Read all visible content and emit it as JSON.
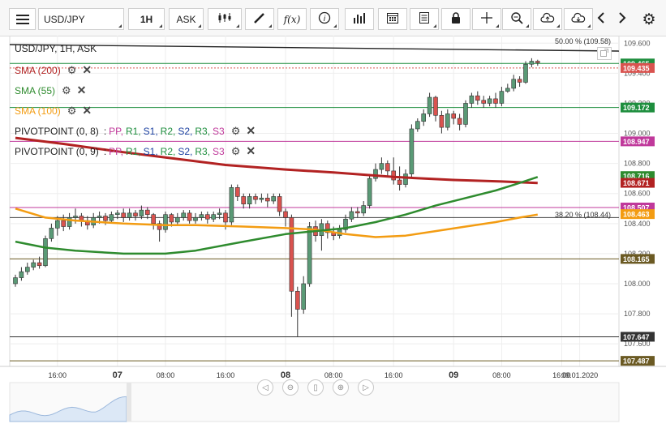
{
  "toolbar": {
    "symbol": "USD/JPY",
    "timeframe": "1H",
    "price_type": "ASK",
    "icons": [
      "menu-icon",
      "candlestick-icon",
      "draw-pen-icon",
      "function-icon",
      "info-icon",
      "bar-chart-icon",
      "calendar-icon",
      "document-icon",
      "lock-icon",
      "crosshair-icon",
      "zoom-icon",
      "upload-cloud-icon",
      "download-cloud-icon",
      "chevron-left-icon",
      "chevron-right-icon",
      "gear-icon"
    ],
    "function_label": "f(x)"
  },
  "legend": {
    "title": "USD/JPY, 1H, ASK",
    "sma200": {
      "label": "SMA (200)",
      "color": "#b22222"
    },
    "sma55": {
      "label": "SMA (55)",
      "color": "#2e8b2e"
    },
    "sma100": {
      "label": "SMA (100)",
      "color": "#f39c12"
    },
    "pivot1": {
      "name": "PIVOTPOINT (0, 8)",
      "sep": ":",
      "pp": "PP,",
      "r1": "R1,",
      "s1": "S1,",
      "r2": "R2,",
      "s2": "S2,",
      "r3": "R3,",
      "s3": "S3"
    },
    "pivot2": {
      "name": "PIVOTPOINT (0, 9)",
      "sep": ":",
      "pp": "PP,",
      "r1": "R1,",
      "s1": "S1,",
      "r2": "R2,",
      "s2": "S2,",
      "r3": "R3,",
      "s3": "S3"
    }
  },
  "fib": {
    "top": {
      "label": "50.00 % (109.58)",
      "value": 109.58
    },
    "bottom": {
      "label": "38.20 % (108.44)",
      "value": 108.44
    }
  },
  "colors": {
    "bull": "#5a9a76",
    "bear": "#d9534f",
    "pp": "#c0399b",
    "r": "#1e8e3e",
    "s": "#1a3fa0"
  },
  "chart_data": {
    "type": "candlestick",
    "symbol": "USD/JPY",
    "ylim": [
      107.45,
      109.65
    ],
    "y_ticks": [
      "109.600",
      "109.400",
      "109.200",
      "109.000",
      "108.800",
      "108.600",
      "108.400",
      "108.200",
      "108.000",
      "107.800",
      "107.600"
    ],
    "x_ticks": [
      {
        "label": "16:00",
        "bold": false,
        "i": 7
      },
      {
        "label": "07",
        "bold": true,
        "i": 17
      },
      {
        "label": "08:00",
        "bold": false,
        "i": 25
      },
      {
        "label": "16:00",
        "bold": false,
        "i": 35
      },
      {
        "label": "08",
        "bold": true,
        "i": 45
      },
      {
        "label": "08:00",
        "bold": false,
        "i": 53
      },
      {
        "label": "16:00",
        "bold": false,
        "i": 63
      },
      {
        "label": "09",
        "bold": true,
        "i": 73
      },
      {
        "label": "08:00",
        "bold": false,
        "i": 81
      },
      {
        "label": "16:00",
        "bold": false,
        "i": 91
      },
      {
        "label": "09.01.2020",
        "bold": false,
        "i": 94
      }
    ],
    "candles": [
      [
        108.0,
        108.04,
        107.98,
        108.06
      ],
      [
        108.04,
        108.08,
        108.02,
        108.11
      ],
      [
        108.08,
        108.11,
        108.06,
        108.14
      ],
      [
        108.11,
        108.14,
        108.09,
        108.16
      ],
      [
        108.14,
        108.12,
        108.1,
        108.18
      ],
      [
        108.12,
        108.3,
        108.11,
        108.32
      ],
      [
        108.3,
        108.37,
        108.28,
        108.4
      ],
      [
        108.37,
        108.42,
        108.32,
        108.45
      ],
      [
        108.42,
        108.38,
        108.35,
        108.46
      ],
      [
        108.38,
        108.44,
        108.36,
        108.47
      ],
      [
        108.44,
        108.45,
        108.4,
        108.5
      ],
      [
        108.45,
        108.42,
        108.38,
        108.47
      ],
      [
        108.42,
        108.39,
        108.36,
        108.45
      ],
      [
        108.39,
        108.44,
        108.37,
        108.47
      ],
      [
        108.44,
        108.45,
        108.4,
        108.48
      ],
      [
        108.45,
        108.42,
        108.39,
        108.47
      ],
      [
        108.42,
        108.46,
        108.4,
        108.48
      ],
      [
        108.46,
        108.47,
        108.43,
        108.49
      ],
      [
        108.47,
        108.44,
        108.41,
        108.5
      ],
      [
        108.44,
        108.47,
        108.42,
        108.5
      ],
      [
        108.47,
        108.45,
        108.42,
        108.49
      ],
      [
        108.45,
        108.49,
        108.43,
        108.52
      ],
      [
        108.49,
        108.46,
        108.43,
        108.51
      ],
      [
        108.46,
        108.4,
        108.36,
        108.47
      ],
      [
        108.4,
        108.36,
        108.28,
        108.42
      ],
      [
        108.36,
        108.46,
        108.34,
        108.48
      ],
      [
        108.46,
        108.41,
        108.38,
        108.47
      ],
      [
        108.41,
        108.44,
        108.39,
        108.47
      ],
      [
        108.44,
        108.47,
        108.42,
        108.49
      ],
      [
        108.47,
        108.42,
        108.4,
        108.49
      ],
      [
        108.42,
        108.44,
        108.4,
        108.47
      ],
      [
        108.44,
        108.46,
        108.42,
        108.48
      ],
      [
        108.46,
        108.43,
        108.4,
        108.48
      ],
      [
        108.43,
        108.46,
        108.41,
        108.48
      ],
      [
        108.46,
        108.47,
        108.43,
        108.5
      ],
      [
        108.47,
        108.41,
        108.36,
        108.49
      ],
      [
        108.41,
        108.64,
        108.39,
        108.66
      ],
      [
        108.64,
        108.58,
        108.55,
        108.66
      ],
      [
        108.58,
        108.53,
        108.5,
        108.6
      ],
      [
        108.53,
        108.58,
        108.5,
        108.6
      ],
      [
        108.58,
        108.56,
        108.53,
        108.6
      ],
      [
        108.56,
        108.57,
        108.54,
        108.6
      ],
      [
        108.57,
        108.55,
        108.51,
        108.6
      ],
      [
        108.55,
        108.58,
        108.53,
        108.6
      ],
      [
        108.58,
        108.48,
        108.45,
        108.6
      ],
      [
        108.48,
        108.44,
        108.38,
        108.5
      ],
      [
        108.44,
        107.95,
        107.78,
        108.46
      ],
      [
        107.95,
        107.83,
        107.65,
        107.98
      ],
      [
        107.83,
        108.0,
        107.8,
        108.05
      ],
      [
        108.0,
        108.38,
        107.98,
        108.41
      ],
      [
        108.38,
        108.32,
        108.28,
        108.42
      ],
      [
        108.32,
        108.4,
        108.22,
        108.43
      ],
      [
        108.4,
        108.34,
        108.3,
        108.42
      ],
      [
        108.34,
        108.32,
        108.29,
        108.38
      ],
      [
        108.32,
        108.36,
        108.3,
        108.39
      ],
      [
        108.36,
        108.43,
        108.34,
        108.46
      ],
      [
        108.43,
        108.48,
        108.41,
        108.51
      ],
      [
        108.48,
        108.47,
        108.44,
        108.51
      ],
      [
        108.47,
        108.52,
        108.45,
        108.55
      ],
      [
        108.52,
        108.7,
        108.5,
        108.73
      ],
      [
        108.7,
        108.76,
        108.68,
        108.8
      ],
      [
        108.76,
        108.8,
        108.73,
        108.84
      ],
      [
        108.8,
        108.75,
        108.71,
        108.82
      ],
      [
        108.75,
        108.69,
        108.66,
        108.84
      ],
      [
        108.69,
        108.66,
        108.62,
        108.78
      ],
      [
        108.66,
        108.73,
        108.64,
        108.76
      ],
      [
        108.73,
        109.03,
        108.71,
        109.06
      ],
      [
        109.03,
        109.08,
        109.01,
        109.1
      ],
      [
        109.08,
        109.13,
        109.05,
        109.16
      ],
      [
        109.13,
        109.24,
        109.11,
        109.27
      ],
      [
        109.24,
        109.12,
        109.08,
        109.25
      ],
      [
        109.12,
        109.04,
        109.0,
        109.15
      ],
      [
        109.04,
        109.13,
        109.02,
        109.16
      ],
      [
        109.13,
        109.1,
        109.06,
        109.15
      ],
      [
        109.1,
        109.06,
        109.02,
        109.13
      ],
      [
        109.06,
        109.2,
        109.04,
        109.22
      ],
      [
        109.2,
        109.25,
        109.17,
        109.27
      ],
      [
        109.25,
        109.22,
        109.19,
        109.28
      ],
      [
        109.22,
        109.2,
        109.17,
        109.25
      ],
      [
        109.2,
        109.23,
        109.18,
        109.25
      ],
      [
        109.23,
        109.2,
        109.17,
        109.27
      ],
      [
        109.2,
        109.28,
        109.18,
        109.31
      ],
      [
        109.28,
        109.3,
        109.27,
        109.33
      ],
      [
        109.3,
        109.36,
        109.28,
        109.39
      ],
      [
        109.36,
        109.34,
        109.31,
        109.38
      ],
      [
        109.34,
        109.46,
        109.33,
        109.48
      ],
      [
        109.46,
        109.48,
        109.44,
        109.5
      ],
      [
        109.48,
        109.47,
        109.45,
        109.49
      ]
    ],
    "sma200": [
      [
        0,
        108.97
      ],
      [
        8,
        108.93
      ],
      [
        17,
        108.88
      ],
      [
        25,
        108.84
      ],
      [
        35,
        108.79
      ],
      [
        45,
        108.76
      ],
      [
        53,
        108.74
      ],
      [
        63,
        108.71
      ],
      [
        73,
        108.69
      ],
      [
        81,
        108.68
      ],
      [
        87,
        108.67
      ]
    ],
    "sma55": [
      [
        0,
        108.28
      ],
      [
        5,
        108.24
      ],
      [
        10,
        108.22
      ],
      [
        18,
        108.2
      ],
      [
        25,
        108.2
      ],
      [
        30,
        108.22
      ],
      [
        38,
        108.28
      ],
      [
        45,
        108.33
      ],
      [
        50,
        108.35
      ],
      [
        55,
        108.37
      ],
      [
        60,
        108.41
      ],
      [
        65,
        108.46
      ],
      [
        70,
        108.52
      ],
      [
        75,
        108.57
      ],
      [
        80,
        108.62
      ],
      [
        84,
        108.67
      ],
      [
        87,
        108.71
      ]
    ],
    "sma100": [
      [
        0,
        108.5
      ],
      [
        5,
        108.44
      ],
      [
        10,
        108.42
      ],
      [
        18,
        108.4
      ],
      [
        25,
        108.39
      ],
      [
        30,
        108.39
      ],
      [
        38,
        108.38
      ],
      [
        45,
        108.37
      ],
      [
        50,
        108.36
      ],
      [
        55,
        108.33
      ],
      [
        60,
        108.31
      ],
      [
        65,
        108.32
      ],
      [
        70,
        108.35
      ],
      [
        75,
        108.38
      ],
      [
        80,
        108.41
      ],
      [
        84,
        108.44
      ],
      [
        87,
        108.46
      ]
    ],
    "levels": [
      {
        "value": 109.465,
        "label": "109.465",
        "color": "#1e8e3e",
        "line": "solid"
      },
      {
        "value": 109.435,
        "label": "109.435",
        "color": "#d9534f",
        "line": "dashed"
      },
      {
        "value": 109.172,
        "label": "109.172",
        "color": "#1e8e3e",
        "line": "solid"
      },
      {
        "value": 108.947,
        "label": "108.947",
        "color": "#c0399b",
        "line": "solid"
      },
      {
        "value": 108.716,
        "label": "108.716",
        "color": "#2e8b2e",
        "line": "none"
      },
      {
        "value": 108.671,
        "label": "108.671",
        "color": "#b22222",
        "line": "none"
      },
      {
        "value": 108.507,
        "label": "108.507",
        "color": "#c0399b",
        "line": "solid"
      },
      {
        "value": 108.463,
        "label": "108.463",
        "color": "#f39c12",
        "line": "none"
      },
      {
        "value": 108.165,
        "label": "108.165",
        "color": "#6b5a23",
        "line": "solid"
      },
      {
        "value": 107.647,
        "label": "107.647",
        "color": "#333333",
        "line": "solid"
      },
      {
        "value": 107.487,
        "label": "107.487",
        "color": "#6b5a23",
        "line": "solid"
      }
    ]
  }
}
